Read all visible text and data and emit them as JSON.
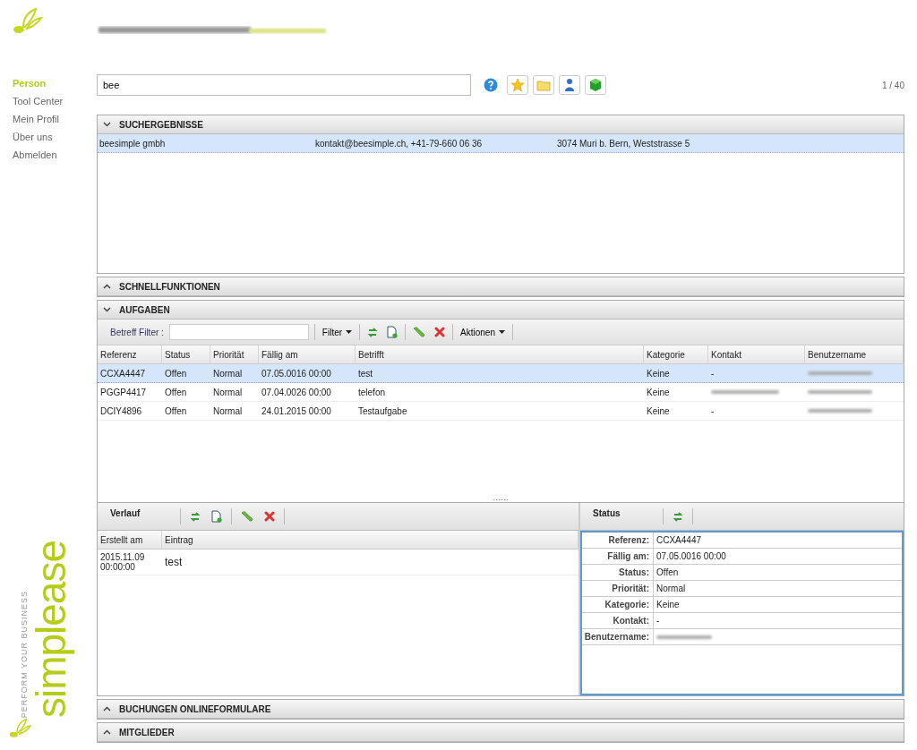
{
  "nav": [
    {
      "label": "Person",
      "selected": true
    },
    {
      "label": "Tool Center",
      "selected": false
    },
    {
      "label": "Mein Profil",
      "selected": false
    },
    {
      "label": "Über uns",
      "selected": false
    },
    {
      "label": "Abmelden",
      "selected": false
    }
  ],
  "brand": {
    "tagline": "PERFORM YOUR BUSINESS",
    "name": "simplease"
  },
  "search": {
    "value": "bee"
  },
  "pager": "1 / 40",
  "search_results": {
    "title": "SUCHERGEBNISSE",
    "expanded": true,
    "rows": [
      {
        "name": "beesimple gmbh",
        "contact": "kontakt@beesimple.ch, +41-79-660 06 36",
        "address": "3074 Muri b. Bern, Weststrasse 5",
        "selected": true
      }
    ]
  },
  "quick_functions": {
    "title": "SCHNELLFUNKTIONEN",
    "expanded": false
  },
  "tasks": {
    "title": "AUFGABEN",
    "expanded": true,
    "filter_label": "Betreff Filter :",
    "filter_menu": "Filter",
    "actions_menu": "Aktionen",
    "columns": [
      "Referenz",
      "Status",
      "Priorität",
      "Fällig am",
      "Betrifft",
      "Kategorie",
      "Kontakt",
      "Benutzername"
    ],
    "rows": [
      {
        "selected": true,
        "cells": [
          {
            "kind": "text",
            "text": "CCXA4447"
          },
          {
            "kind": "text",
            "text": "Offen"
          },
          {
            "kind": "text",
            "text": "Normal"
          },
          {
            "kind": "text",
            "text": "07.05.0016 00:00"
          },
          {
            "kind": "text",
            "text": "test"
          },
          {
            "kind": "text",
            "text": "Keine"
          },
          {
            "kind": "text",
            "text": "-"
          },
          {
            "kind": "blurred"
          }
        ]
      },
      {
        "selected": false,
        "cells": [
          {
            "kind": "text",
            "text": "PGGP4417"
          },
          {
            "kind": "text",
            "text": "Offen"
          },
          {
            "kind": "text",
            "text": "Normal"
          },
          {
            "kind": "text",
            "text": "07.04.0026 00:00"
          },
          {
            "kind": "text",
            "text": "telefon"
          },
          {
            "kind": "text",
            "text": "Keine"
          },
          {
            "kind": "blurred"
          },
          {
            "kind": "blurred"
          }
        ]
      },
      {
        "selected": false,
        "cells": [
          {
            "kind": "text",
            "text": "DCIY4896"
          },
          {
            "kind": "text",
            "text": "Offen"
          },
          {
            "kind": "text",
            "text": "Normal"
          },
          {
            "kind": "text",
            "text": "24.01.2015 00:00"
          },
          {
            "kind": "text",
            "text": "Testaufgabe"
          },
          {
            "kind": "text",
            "text": "Keine"
          },
          {
            "kind": "text",
            "text": "-"
          },
          {
            "kind": "blurred"
          }
        ]
      }
    ]
  },
  "history": {
    "title": "Verlauf",
    "columns": [
      "Erstellt am",
      "Eintrag"
    ],
    "rows": [
      {
        "created": "2015.11.09 00:00:00",
        "entry": "test"
      }
    ]
  },
  "status_panel": {
    "title": "Status",
    "fields": [
      {
        "label": "Referenz:",
        "kind": "text",
        "value": "CCXA4447"
      },
      {
        "label": "Fällig am:",
        "kind": "text",
        "value": "07.05.0016 00:00"
      },
      {
        "label": "Status:",
        "kind": "text",
        "value": "Offen"
      },
      {
        "label": "Priorität:",
        "kind": "text",
        "value": "Normal"
      },
      {
        "label": "Kategorie:",
        "kind": "text",
        "value": "Keine"
      },
      {
        "label": "Kontakt:",
        "kind": "text",
        "value": "-"
      },
      {
        "label": "Benutzername:",
        "kind": "blurred"
      }
    ]
  },
  "bottom_sections": [
    {
      "title": "BUCHUNGEN ONLINEFORMULARE",
      "expanded": false
    },
    {
      "title": "MITGLIEDER",
      "expanded": false
    }
  ]
}
